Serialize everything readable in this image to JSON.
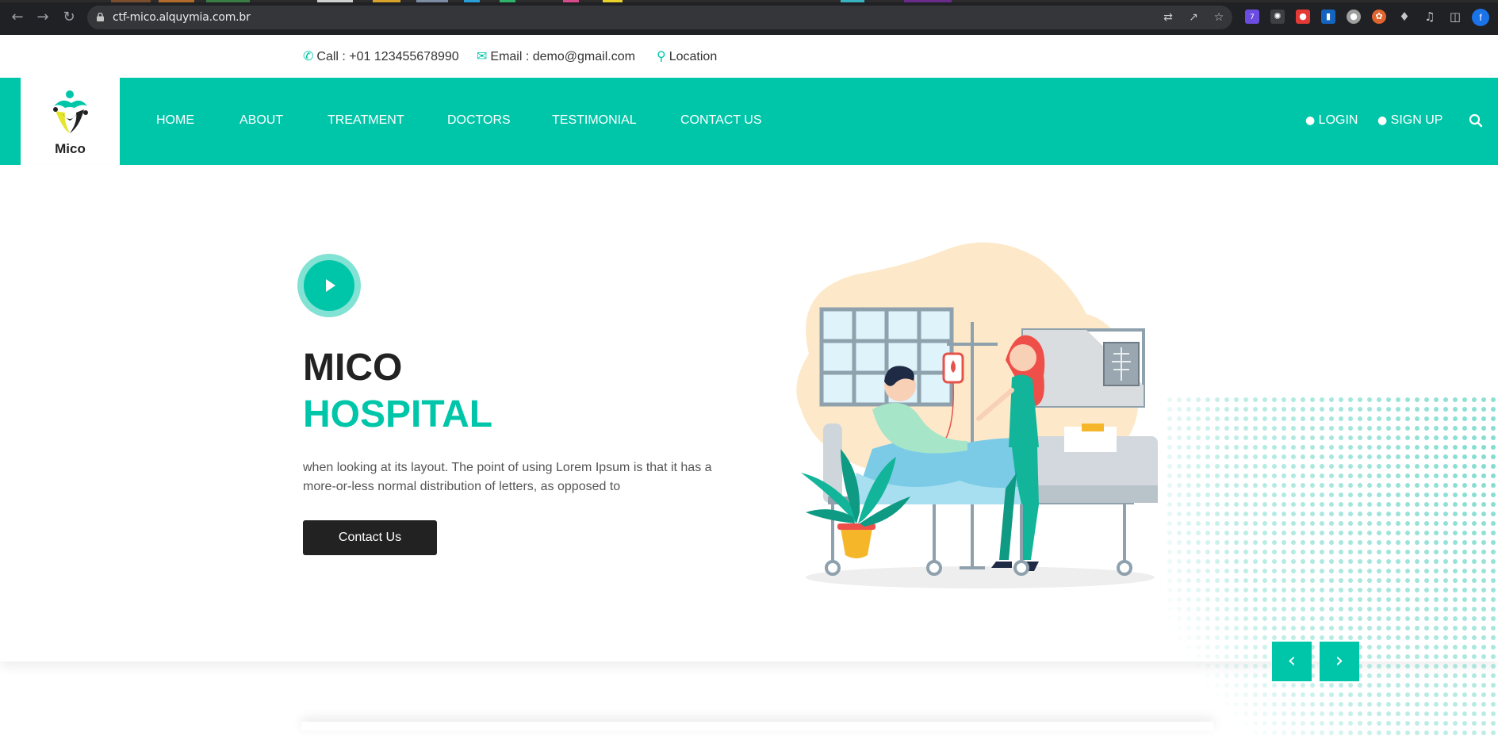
{
  "browser": {
    "url": "ctf-mico.alquymia.com.br",
    "extension_badge": "7",
    "profile_initial": "f"
  },
  "topbar": {
    "call": "Call : +01 123455678990",
    "email": "Email : demo@gmail.com",
    "location": "Location"
  },
  "header": {
    "logo_text": "Mico",
    "menu": [
      "HOME",
      "ABOUT",
      "TREATMENT",
      "DOCTORS",
      "TESTIMONIAL",
      "CONTACT US"
    ],
    "login": "LOGIN",
    "signup": "SIGN UP"
  },
  "hero": {
    "title_line1": "MICO",
    "title_line2": "HOSPITAL",
    "description": "when looking at its layout. The point of using Lorem Ipsum is that it has a more-or-less normal distribution of letters, as opposed to",
    "cta": "Contact Us",
    "prev": "‹",
    "next": "›"
  },
  "colors": {
    "accent": "#00c6a9",
    "dark": "#222222"
  }
}
